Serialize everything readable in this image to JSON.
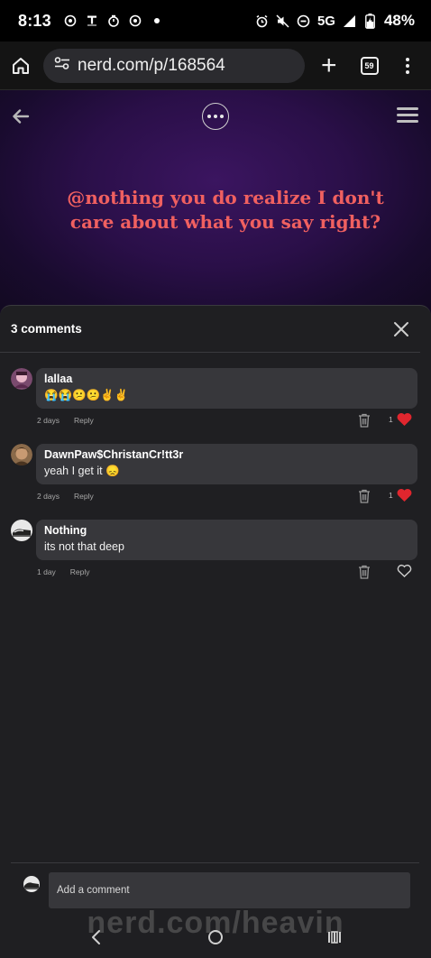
{
  "status_bar": {
    "time": "8:13",
    "network": "5G",
    "battery": "48%"
  },
  "browser": {
    "url": "nerd.com/p/168564",
    "tab_count": "59"
  },
  "post": {
    "text": "@nothing you do realize I don't care about what you say right?"
  },
  "comments_panel": {
    "title": "3 comments",
    "comments": [
      {
        "author": "lallaa",
        "text": "😭😭😕😕✌️✌️",
        "time": "2 days",
        "reply_label": "Reply",
        "likes": "1",
        "liked": true
      },
      {
        "author": "DawnPaw$ChristanCr!tt3r",
        "text": "yeah I get it 😞",
        "time": "2 days",
        "reply_label": "Reply",
        "likes": "1",
        "liked": true
      },
      {
        "author": "Nothing",
        "text": "its not that deep",
        "time": "1 day",
        "reply_label": "Reply",
        "likes": "",
        "liked": false
      }
    ],
    "add_comment_placeholder": "Add a comment"
  },
  "watermark": "nerd.com/heavin",
  "colors": {
    "accent_heart": "#e0262e",
    "post_text": "#f06060",
    "hero_bg": "#2a0f48",
    "sheet_bg": "#1f1f22",
    "bubble_bg": "#37373b"
  }
}
